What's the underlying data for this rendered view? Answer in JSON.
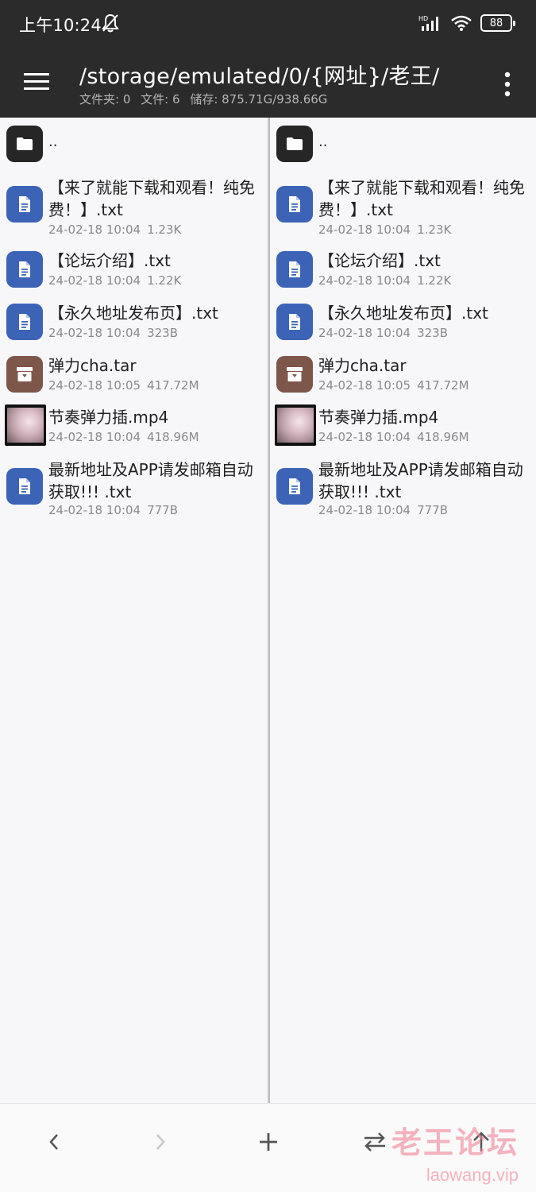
{
  "status_bar": {
    "time": "上午10:24",
    "battery": "88"
  },
  "toolbar": {
    "path": "/storage/emulated/0/{网址}/老王/",
    "info": {
      "folders": "文件夹: 0",
      "files": "文件: 6",
      "storage": "储存: 875.71G/938.66G"
    }
  },
  "panes": [
    {
      "parent_label": "..",
      "files": [
        {
          "name": "【来了就能下载和观看！纯免费！】.txt",
          "date": "24-02-18 10:04",
          "size": "1.23K",
          "type": "doc"
        },
        {
          "name": "【论坛介绍】.txt",
          "date": "24-02-18 10:04",
          "size": "1.22K",
          "type": "doc"
        },
        {
          "name": "【永久地址发布页】.txt",
          "date": "24-02-18 10:04",
          "size": "323B",
          "type": "doc"
        },
        {
          "name": "弹力cha.tar",
          "date": "24-02-18 10:05",
          "size": "417.72M",
          "type": "archive"
        },
        {
          "name": "节奏弹力插.mp4",
          "date": "24-02-18 10:04",
          "size": "418.96M",
          "type": "video"
        },
        {
          "name": "最新地址及APP请发邮箱自动获取!!! .txt",
          "date": "24-02-18 10:04",
          "size": "777B",
          "type": "doc"
        }
      ]
    },
    {
      "parent_label": "..",
      "files": [
        {
          "name": "【来了就能下载和观看！纯免费！】.txt",
          "date": "24-02-18 10:04",
          "size": "1.23K",
          "type": "doc"
        },
        {
          "name": "【论坛介绍】.txt",
          "date": "24-02-18 10:04",
          "size": "1.22K",
          "type": "doc"
        },
        {
          "name": "【永久地址发布页】.txt",
          "date": "24-02-18 10:04",
          "size": "323B",
          "type": "doc"
        },
        {
          "name": "弹力cha.tar",
          "date": "24-02-18 10:05",
          "size": "417.72M",
          "type": "archive"
        },
        {
          "name": "节奏弹力插.mp4",
          "date": "24-02-18 10:04",
          "size": "418.96M",
          "type": "video"
        },
        {
          "name": "最新地址及APP请发邮箱自动获取!!! .txt",
          "date": "24-02-18 10:04",
          "size": "777B",
          "type": "doc"
        }
      ]
    }
  ],
  "watermark": {
    "text": "老王论坛",
    "url": "laowang.vip"
  },
  "colors": {
    "header_bg": "#2b2b2b",
    "doc_icon": "#3d63b6",
    "archive_icon": "#7d574a",
    "folder_icon": "#262626"
  }
}
